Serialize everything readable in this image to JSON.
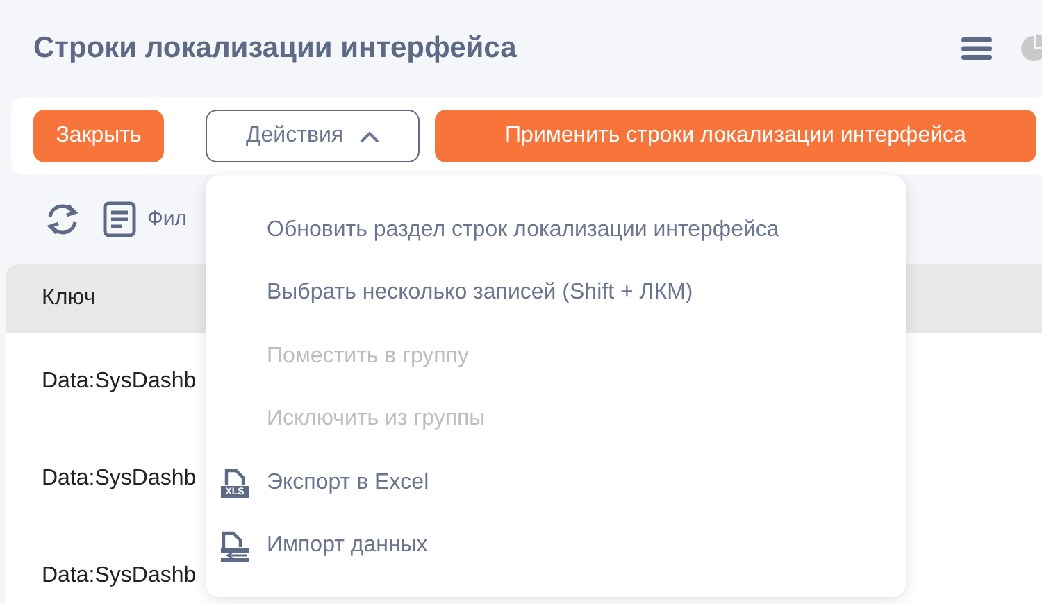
{
  "header": {
    "title": "Строки локализации интерфейса"
  },
  "toolbar": {
    "buttons": [
      {
        "label": "Закрыть",
        "kind": "primary"
      },
      {
        "label": "Действия",
        "kind": "dropdown",
        "expanded": true
      },
      {
        "label": "Применить строки локализации интерфейса",
        "kind": "primary"
      }
    ]
  },
  "grid_toolbar": {
    "filter_label": "Фил"
  },
  "table": {
    "columns": [
      "Ключ"
    ],
    "rows": [
      [
        "Data:SysDashb"
      ],
      [
        "Data:SysDashb"
      ],
      [
        "Data:SysDashb"
      ]
    ]
  },
  "actions_menu": {
    "items": [
      {
        "label": "Обновить раздел строк локализации интерфейса",
        "disabled": false
      },
      {
        "label": "Выбрать несколько записей (Shift + ЛКМ)",
        "disabled": false
      },
      {
        "label": "Поместить в группу",
        "disabled": true
      },
      {
        "label": "Исключить из группы",
        "disabled": true
      },
      {
        "label": "Экспорт в Excel",
        "disabled": false,
        "kind": "export",
        "icon_text": "XLS"
      },
      {
        "label": "Импорт данных",
        "disabled": false,
        "kind": "import"
      }
    ]
  }
}
